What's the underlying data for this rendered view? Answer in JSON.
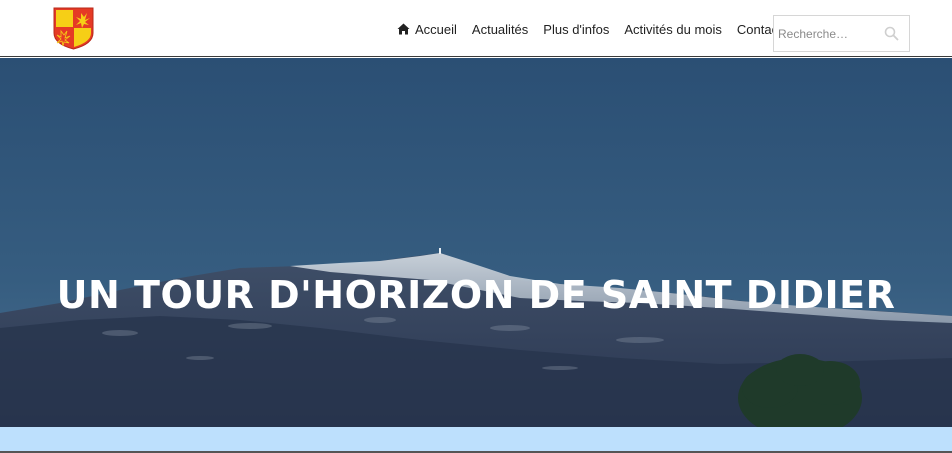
{
  "header": {
    "logo": {
      "icon": "coat-of-arms-occitan-cross",
      "colors": {
        "field": "#e53a25",
        "cross": "#f6cf16"
      }
    },
    "nav": [
      {
        "label": "Accueil",
        "icon": "home-icon"
      },
      {
        "label": "Actualités"
      },
      {
        "label": "Plus d'infos"
      },
      {
        "label": "Activités du mois"
      },
      {
        "label": "Contact"
      }
    ],
    "search": {
      "placeholder": "Recherche…",
      "value": "",
      "icon": "search-icon"
    }
  },
  "hero": {
    "title": "UN TOUR D'HORIZON DE SAINT DIDIER",
    "background": "mountain-landscape-snow-ventoux"
  },
  "colors": {
    "sky": "#2c5478",
    "band": "#bde0fd",
    "nav_text": "#222222"
  }
}
